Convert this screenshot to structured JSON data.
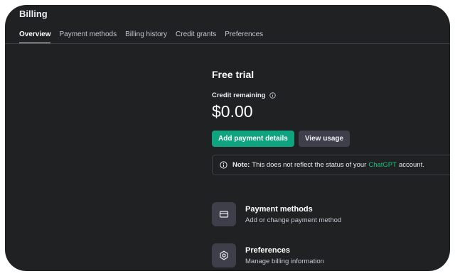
{
  "header": {
    "title": "Billing"
  },
  "tabs": [
    {
      "label": "Overview",
      "active": true
    },
    {
      "label": "Payment methods",
      "active": false
    },
    {
      "label": "Billing history",
      "active": false
    },
    {
      "label": "Credit grants",
      "active": false
    },
    {
      "label": "Preferences",
      "active": false
    }
  ],
  "overview": {
    "plan_name": "Free trial",
    "credit_label": "Credit remaining",
    "credit_value": "$0.00",
    "add_payment_label": "Add payment details",
    "view_usage_label": "View usage",
    "note": {
      "bold": "Note:",
      "text_before": "This does not reflect the status of your",
      "link": "ChatGPT",
      "text_after": "account."
    }
  },
  "cards": [
    {
      "title": "Payment methods",
      "description": "Add or change payment method",
      "icon": "credit-card-icon"
    },
    {
      "title": "Preferences",
      "description": "Manage billing information",
      "icon": "settings-gear-icon"
    }
  ],
  "colors": {
    "background": "#202123",
    "accent": "#10a37f",
    "link": "#19c37d",
    "secondary_button": "#3e3f4b"
  }
}
